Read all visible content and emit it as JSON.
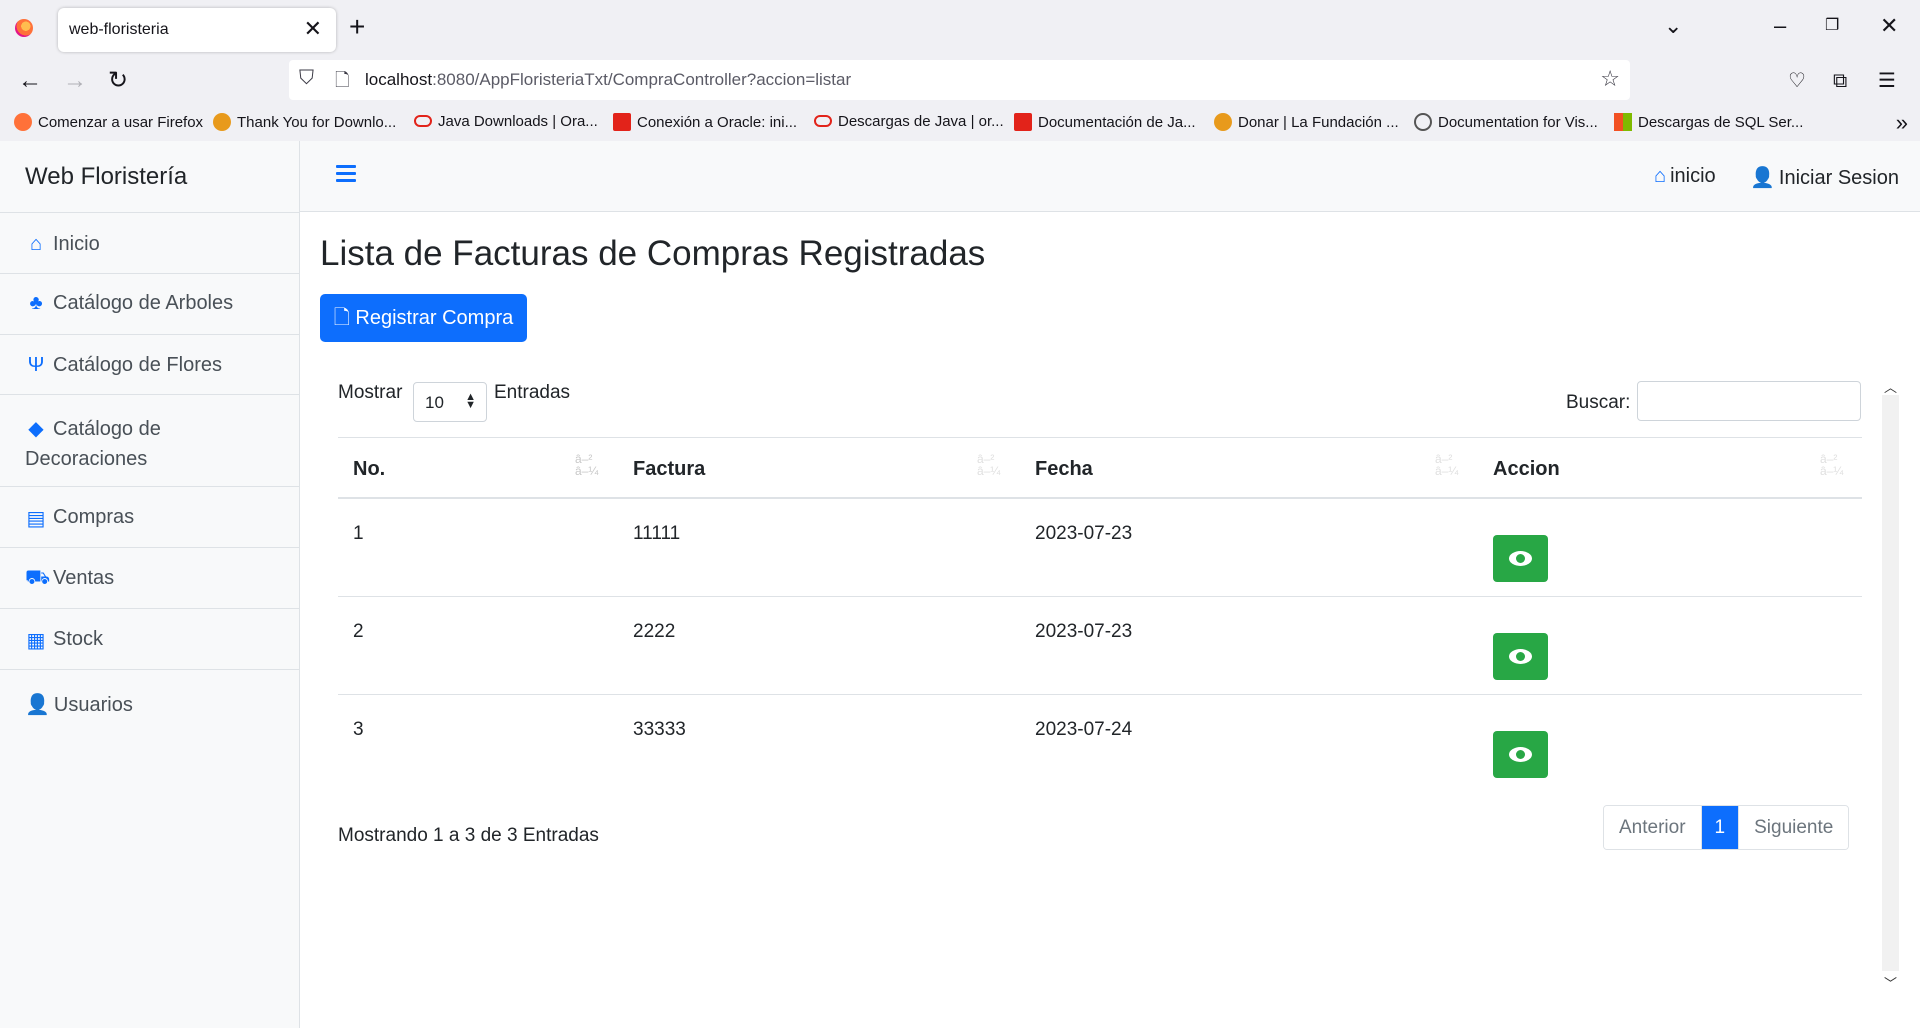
{
  "browser": {
    "tab_title": "web-floristeria",
    "url_host": "localhost",
    "url_rest": ":8080/AppFloristeriaTxt/CompraController?accion=listar",
    "bookmarks": [
      {
        "label": "Comenzar a usar Firefox",
        "color": "#ff7139"
      },
      {
        "label": "Thank You for Downlo...",
        "color": "#e89a1c"
      },
      {
        "label": "Java Downloads | Ora...",
        "color": "#e2231a"
      },
      {
        "label": "Conexión a Oracle: ini...",
        "color": "#e2231a"
      },
      {
        "label": "Descargas de Java | or...",
        "color": "#e2231a"
      },
      {
        "label": "Documentación de Ja...",
        "color": "#e2231a"
      },
      {
        "label": "Donar | La Fundación ...",
        "color": "#e89a1c"
      },
      {
        "label": "Documentation for Vis...",
        "color": "#555555"
      },
      {
        "label": "Descargas de SQL Ser...",
        "color": "#00a4ef"
      }
    ]
  },
  "sidebar": {
    "brand": "Web Floristería",
    "items": [
      {
        "label": "Inicio",
        "icon": "home-icon"
      },
      {
        "label": "Catálogo de Arboles",
        "icon": "tree-icon"
      },
      {
        "label": "Catálogo de Flores",
        "icon": "seedling-icon"
      },
      {
        "label": "Catálogo de Decoraciones",
        "icon": "gem-icon"
      },
      {
        "label": "Compras",
        "icon": "store-icon"
      },
      {
        "label": "Ventas",
        "icon": "truck-icon"
      },
      {
        "label": "Stock",
        "icon": "boxes-icon"
      },
      {
        "label": "Usuarios",
        "icon": "user-icon"
      }
    ]
  },
  "topbar": {
    "home_label": "inicio",
    "login_label": "Iniciar Sesion"
  },
  "main": {
    "title": "Lista de Facturas de Compras Registradas",
    "register_button": "Registrar Compra",
    "show_label": "Mostrar",
    "page_size": "10",
    "entries_label": "Entradas",
    "search_label": "Buscar:",
    "search_value": "",
    "sort_glyph_top": "â–²",
    "sort_glyph_bottom": "â–¼",
    "columns": [
      "No.",
      "Factura",
      "Fecha",
      "Accion"
    ],
    "rows": [
      {
        "no": "1",
        "factura": "11111",
        "fecha": "2023-07-23"
      },
      {
        "no": "2",
        "factura": "2222",
        "fecha": "2023-07-23"
      },
      {
        "no": "3",
        "factura": "33333",
        "fecha": "2023-07-24"
      }
    ],
    "info": "Mostrando 1 a 3 de 3 Entradas",
    "pager": {
      "prev": "Anterior",
      "current": "1",
      "next": "Siguiente"
    },
    "colors": {
      "primary": "#0d6efd",
      "success": "#28a745"
    }
  }
}
